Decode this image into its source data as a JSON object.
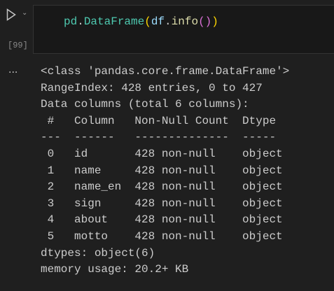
{
  "cell": {
    "execution_count": "[99]",
    "code_tokens": [
      {
        "text": "pd",
        "color": "#4ec9b0"
      },
      {
        "text": ".",
        "color": "#cccccc"
      },
      {
        "text": "DataFrame",
        "color": "#4ec9b0"
      },
      {
        "text": "(",
        "color": "#ffd700"
      },
      {
        "text": "df",
        "color": "#9cdcfe"
      },
      {
        "text": ".",
        "color": "#cccccc"
      },
      {
        "text": "info",
        "color": "#dcdcaa"
      },
      {
        "text": "()",
        "color": "#da70d6"
      },
      {
        "text": ")",
        "color": "#ffd700"
      }
    ]
  },
  "output": {
    "more_label": "...",
    "lines": [
      "<class 'pandas.core.frame.DataFrame'>",
      "RangeIndex: 428 entries, 0 to 427",
      "Data columns (total 6 columns):",
      " #   Column   Non-Null Count  Dtype ",
      "---  ------   --------------  ----- ",
      " 0   id       428 non-null    object",
      " 1   name     428 non-null    object",
      " 2   name_en  428 non-null    object",
      " 3   sign     428 non-null    object",
      " 4   about    428 non-null    object",
      " 5   motto    428 non-null    object",
      "dtypes: object(6)",
      "memory usage: 20.2+ KB"
    ]
  }
}
